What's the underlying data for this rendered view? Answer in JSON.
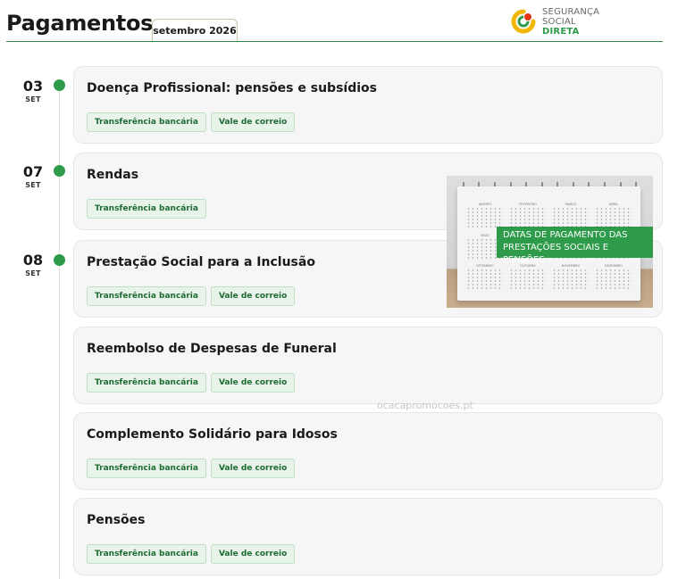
{
  "header": {
    "title": "Pagamentos",
    "month_tab": "setembro 2026"
  },
  "logo": {
    "line1": "SEGURANÇA SOCIAL",
    "line2": "DIRETA"
  },
  "dates": [
    {
      "day": "03",
      "month": "SET"
    },
    {
      "day": "07",
      "month": "SET"
    },
    {
      "day": "08",
      "month": "SET"
    }
  ],
  "cards": [
    {
      "title": "Doença Profissional: pensões e subsídios",
      "tags": [
        "Transferência bancária",
        "Vale de correio"
      ]
    },
    {
      "title": "Rendas",
      "tags": [
        "Transferência bancária"
      ]
    },
    {
      "title": "Prestação Social para a Inclusão",
      "tags": [
        "Transferência bancária",
        "Vale de correio"
      ]
    },
    {
      "title": "Reembolso de Despesas de Funeral",
      "tags": [
        "Transferência bancária",
        "Vale de correio"
      ]
    },
    {
      "title": "Complemento Solidário para Idosos",
      "tags": [
        "Transferência bancária",
        "Vale de correio"
      ]
    },
    {
      "title": "Pensões",
      "tags": [
        "Transferência bancária",
        "Vale de correio"
      ]
    }
  ],
  "promo": {
    "line1": "DATAS DE PAGAMENTO DAS",
    "line2": "PRESTAÇÕES SOCIAIS E PENSÕES",
    "months": [
      "JANEIRO",
      "FEVEREIRO",
      "MARÇO",
      "ABRIL",
      "MAIO",
      "",
      "",
      "",
      "SETEMBRO",
      "OUTUBRO",
      "NOVEMBRO",
      "DEZEMBRO"
    ]
  },
  "watermark": "ocacapromocoes.pt",
  "colors": {
    "brand_green": "#2e9b4a",
    "tag_text": "#1f6b34",
    "tag_bg": "#e8f4ea"
  }
}
